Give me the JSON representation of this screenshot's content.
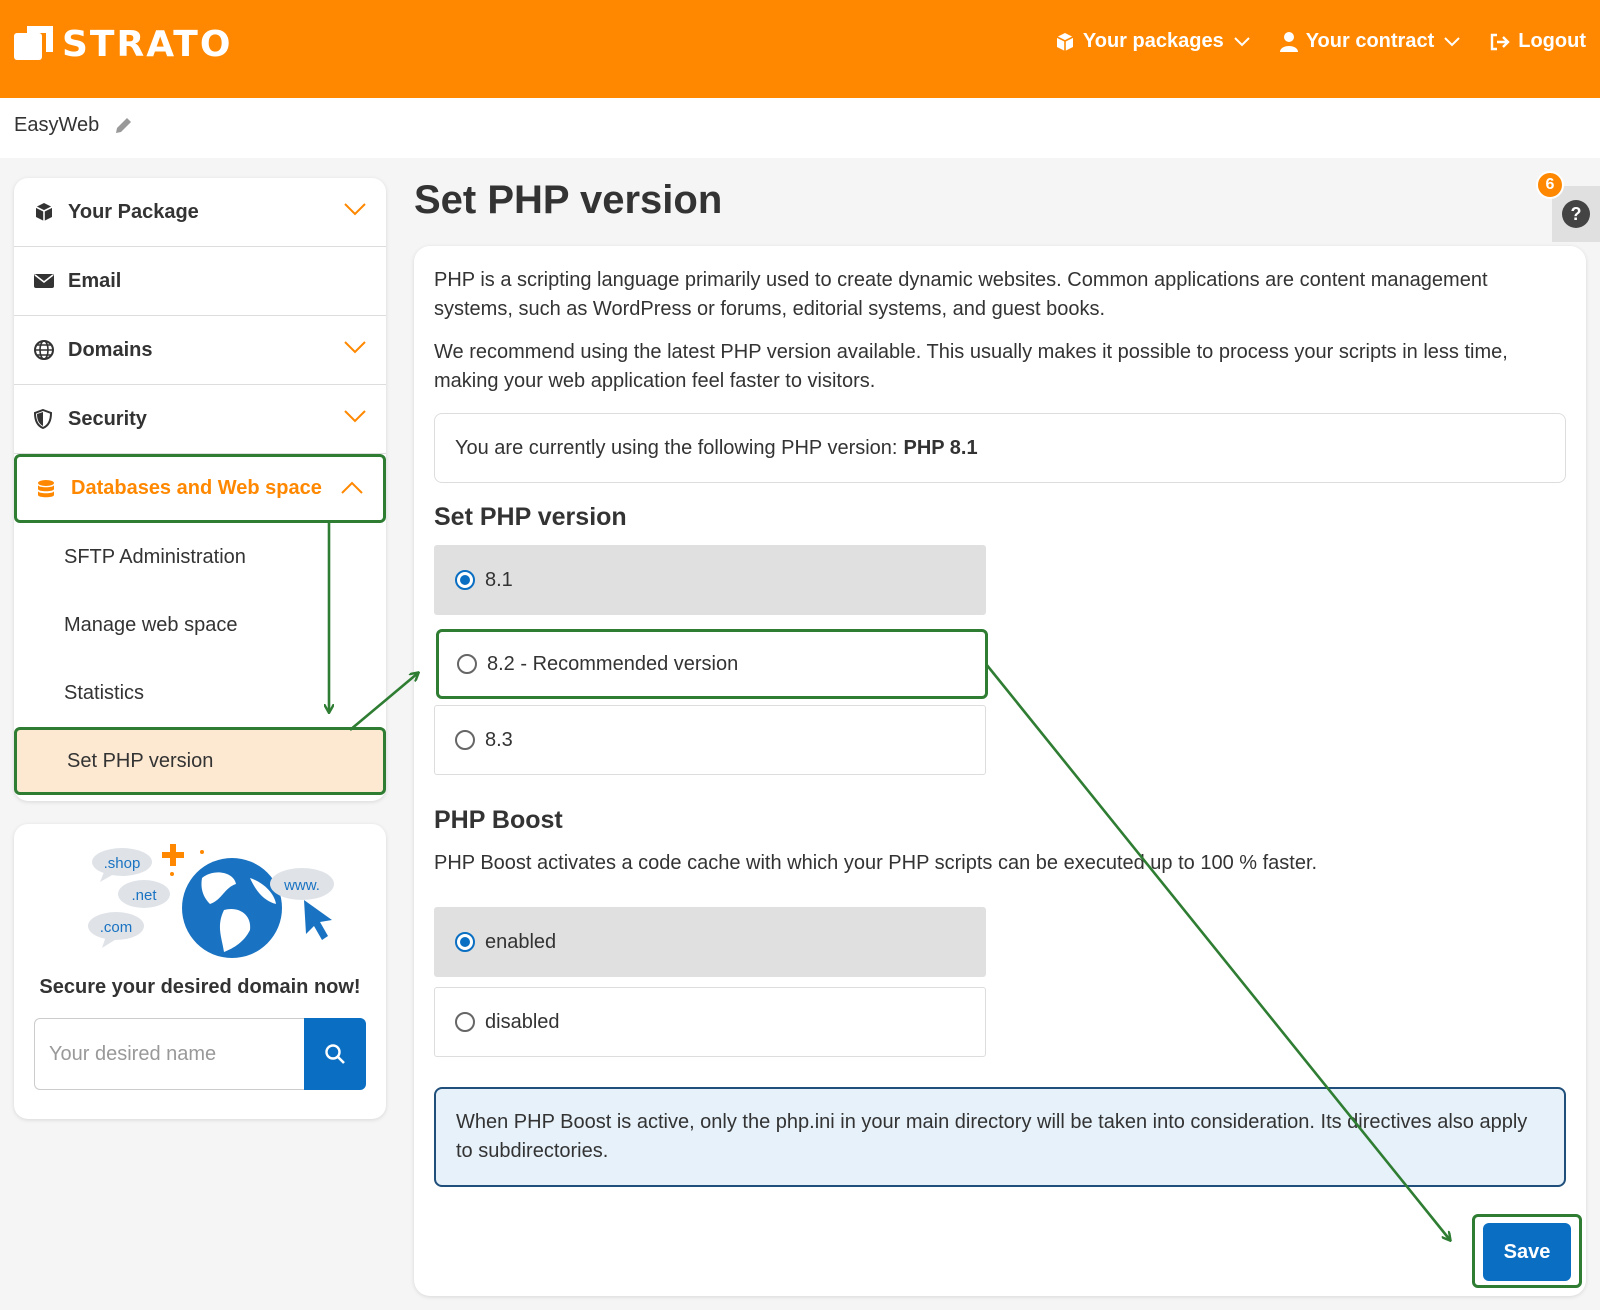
{
  "header": {
    "brand": "STRATO",
    "nav": {
      "packages": "Your packages",
      "contract": "Your contract",
      "logout": "Logout"
    }
  },
  "breadcrumb": {
    "title": "EasyWeb"
  },
  "sidebar": {
    "items": [
      {
        "label": "Your Package",
        "icon": "package-icon"
      },
      {
        "label": "Email",
        "icon": "envelope-icon"
      },
      {
        "label": "Domains",
        "icon": "globe-icon"
      },
      {
        "label": "Security",
        "icon": "shield-icon"
      },
      {
        "label": "Databases and Web space",
        "icon": "database-icon"
      }
    ],
    "sub_items": [
      "SFTP Administration",
      "Manage web space",
      "Statistics",
      "Set PHP version"
    ]
  },
  "domain_card": {
    "tags": [
      ".shop",
      ".net",
      ".com",
      "www."
    ],
    "title": "Secure your desired domain now!",
    "input_placeholder": "Your desired name"
  },
  "main": {
    "title": "Set PHP version",
    "help_badge": "6",
    "help_icon": "?",
    "intro_1": "PHP is a scripting language primarily used to create dynamic websites. Common applications are content management systems, such as WordPress or forums, editorial systems, and guest books.",
    "intro_2": "We recommend using the latest PHP version available. This usually makes it possible to process your scripts in less time, making your web application feel faster to visitors.",
    "current_label": "You are currently using the following PHP version:",
    "current_value": "PHP 8.1",
    "version_section_title": "Set PHP version",
    "versions": [
      {
        "label": "8.1",
        "selected": true
      },
      {
        "label": "8.2 - Recommended version",
        "selected": false
      },
      {
        "label": "8.3",
        "selected": false
      }
    ],
    "boost_title": "PHP Boost",
    "boost_desc": "PHP Boost activates a code cache with which your PHP scripts can be executed up to 100 % faster.",
    "boost_options": [
      {
        "label": "enabled",
        "selected": true
      },
      {
        "label": "disabled",
        "selected": false
      }
    ],
    "boost_info": "When PHP Boost is active, only the php.ini in your main directory will be taken into consideration. Its directives also apply to subdirectories.",
    "save_label": "Save"
  },
  "colors": {
    "brand": "#ff8800",
    "primary": "#0a6fc2",
    "highlight": "#2e7d32"
  }
}
